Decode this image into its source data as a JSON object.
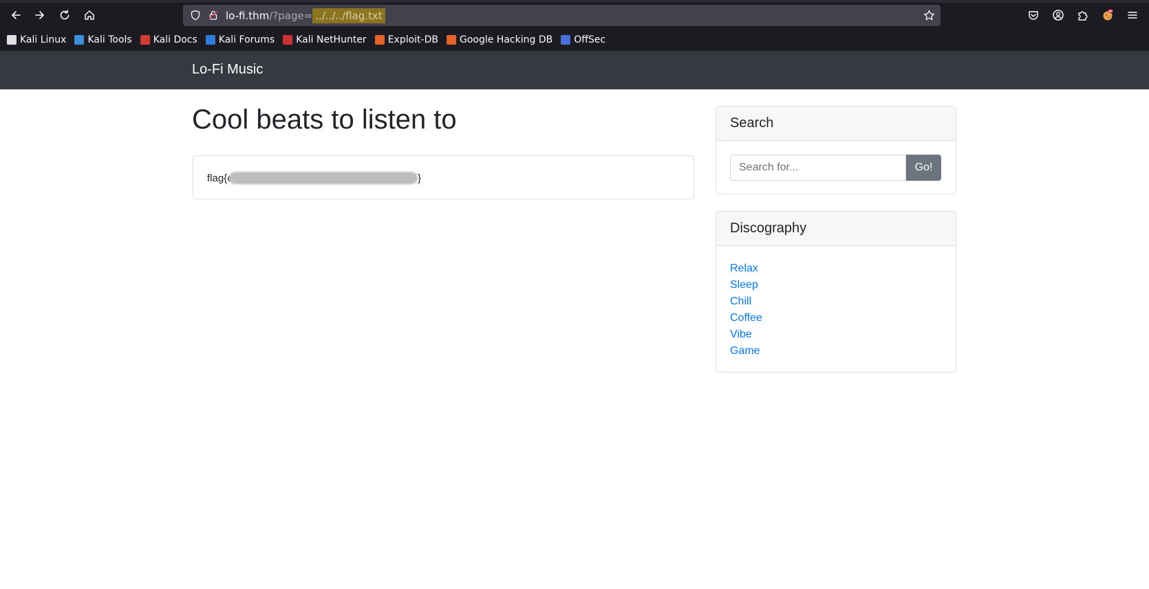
{
  "browser": {
    "url": {
      "host": "lo-fi.thm",
      "query_prefix": "/?page=",
      "query_highlight": "../../../flag.txt"
    },
    "bookmarks": [
      {
        "label": "Kali Linux",
        "color": "#e0e0e0"
      },
      {
        "label": "Kali Tools",
        "color": "#3d8fd8"
      },
      {
        "label": "Kali Docs",
        "color": "#d23b2f"
      },
      {
        "label": "Kali Forums",
        "color": "#2f7bd8"
      },
      {
        "label": "Kali NetHunter",
        "color": "#cc3333"
      },
      {
        "label": "Exploit-DB",
        "color": "#e8632a"
      },
      {
        "label": "Google Hacking DB",
        "color": "#e8632a"
      },
      {
        "label": "OffSec",
        "color": "#4a6fd8"
      }
    ]
  },
  "page": {
    "brand": "Lo-Fi Music",
    "heading": "Cool beats to listen to",
    "flag": {
      "visible_prefix": "flag{e",
      "visible_suffix": "}"
    },
    "search": {
      "title": "Search",
      "placeholder": "Search for...",
      "button": "Go!"
    },
    "discography": {
      "title": "Discography",
      "items": [
        "Relax",
        "Sleep",
        "Chill",
        "Coffee",
        "Vibe",
        "Game"
      ]
    }
  }
}
